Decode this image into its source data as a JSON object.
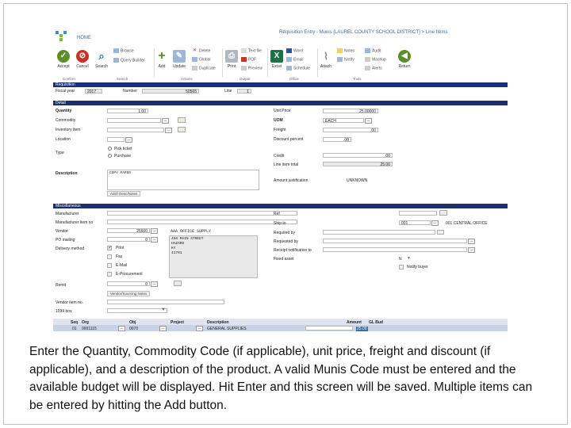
{
  "topbar": {
    "home": "HOME",
    "window_title": "Requisition Entry - Munis [LAUREL COUNTY SCHOOL DISTRICT] > Line Items"
  },
  "ribbon": {
    "accept": "Accept",
    "cancel": "Cancel",
    "search": "Search",
    "browse": "Browse",
    "query_builder": "Query Builder",
    "add": "Add",
    "update": "Update",
    "delete": "Delete",
    "global": "Global",
    "duplicate": "Duplicate",
    "print": "Print",
    "text_file": "Text file",
    "pdf": "PDF",
    "preview": "Preview",
    "excel": "Excel",
    "word": "Word",
    "email": "Email",
    "schedule": "Schedule",
    "attach": "Attach",
    "notes": "Notes",
    "notify": "Notify",
    "audit": "Audit",
    "mashup": "Mashup",
    "alerts": "Alerts",
    "return": "Return",
    "groups": {
      "confirm": "Confirm",
      "search": "Search",
      "actions": "Actions",
      "output": "Output",
      "office": "Office",
      "tools": "Tools"
    }
  },
  "requisition": {
    "section": "Requisition",
    "fy_label": "Fiscal year",
    "fy": "2017",
    "number_label": "Number",
    "number": "50565",
    "line_label": "Line",
    "line": "1"
  },
  "detail": {
    "section": "Detail",
    "quantity_label": "Quantity",
    "quantity": "1.00",
    "commodity_label": "Commodity",
    "commodity": "",
    "inventory_label": "Inventory item",
    "inventory": "",
    "location_label": "Location",
    "location": "",
    "type_label": "Type",
    "type_options": [
      "Pick ticket",
      "Purchase"
    ],
    "description_label": "Description",
    "description": "COPY PAPER",
    "add_desc_button": "Add'l Desc/Notes",
    "unit_price_label": "Unit Price",
    "unit_price": "25.00000",
    "uom_label": "UOM",
    "uom": "EACH",
    "freight_label": "Freight",
    "freight": ".00",
    "discount_label": "Discount percent",
    "discount": ".00",
    "credit_label": "Credit",
    "credit": ".00",
    "line_total_label": "Line item total",
    "line_total": "25.00",
    "justification_label": "Amount justification",
    "justification": "UNKNOWN"
  },
  "misc": {
    "section": "Miscellaneous",
    "manufacturer_label": "Manufacturer",
    "manufacturer": "",
    "mfr_item_label": "Manufacturer item no",
    "mfr_item": "",
    "vendor_label": "Vendor",
    "vendor": "26600",
    "vendor_name": "AAA OFFICE SUPPLY",
    "po_mailing_label": "PO mailing",
    "po_mailing": "0",
    "address": "456 MAIN STREET\nHAZARD\nKY\n41701",
    "delivery_label": "Delivery method",
    "delivery_options": [
      "Print",
      "Fax",
      "E-Mail",
      "E-Procurement"
    ],
    "remit_label": "Remit",
    "remit": "0",
    "vendor_notes_button": "Vendor/Sourcing Notes",
    "vendor_item_label": "Vendor item no.",
    "vendor_item": "",
    "box_1099_label": "1099 box",
    "box_1099": "",
    "ref_label": "Ref",
    "ref": "",
    "ship_to_label": "Ship to",
    "ship_to": "001",
    "ship_to_name": "001 CENTRAL OFFICE",
    "required_by_label": "Required by",
    "required_by": "",
    "requested_by_label": "Requested by",
    "requested_by": "",
    "receipt_label": "Receipt notification to",
    "receipt": "",
    "fixed_asset_label": "Fixed asset",
    "fixed_asset": "N",
    "notify_buyer_label": "Notify buyer"
  },
  "grid": {
    "headers": [
      "Seq",
      "Org",
      "Obj",
      "Project",
      "Description",
      "Amount",
      "GL Bud"
    ],
    "row": {
      "seq": "01",
      "org": "0001115",
      "obj": "0070",
      "project": "",
      "description": "GENERAL SUPPLIES",
      "amount": "",
      "budget": "25.00"
    }
  },
  "caption": "Enter the Quantity, Commodity Code (if applicable), unit price, freight and discount (if applicable), and a description of the product.  A valid Munis Code must be entered and the available budget will be displayed.  Hit Enter and this screen will be saved.  Multiple items can be entered by hitting the Add button.",
  "colors": {
    "section_bar": "#1c2e6b",
    "accept": "#5a8f2c",
    "cancel": "#c8312a",
    "return": "#5a8f2c",
    "grid_row": "#c8d3e6"
  }
}
